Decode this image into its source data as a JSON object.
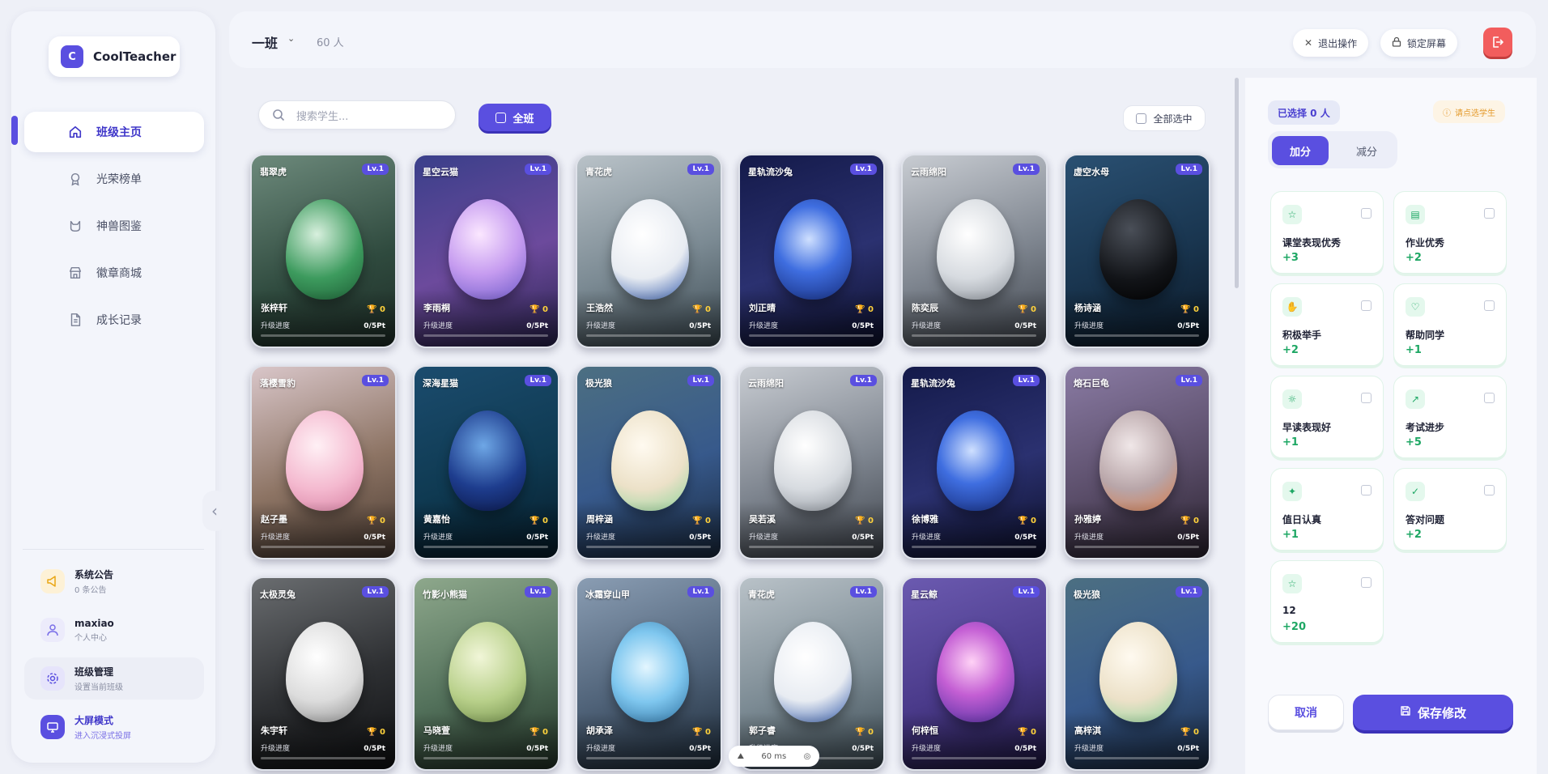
{
  "app": {
    "logo_letter": "C",
    "name": "CoolTeacher"
  },
  "nav": [
    {
      "label": "班级主页",
      "icon": "home-icon",
      "active": true
    },
    {
      "label": "光荣榜单",
      "icon": "medal-icon",
      "active": false
    },
    {
      "label": "神兽图鉴",
      "icon": "cat-icon",
      "active": false
    },
    {
      "label": "徽章商城",
      "icon": "store-icon",
      "active": false
    },
    {
      "label": "成长记录",
      "icon": "document-icon",
      "active": false
    }
  ],
  "sidebar_bottom": [
    {
      "title": "系统公告",
      "subtitle": "0 条公告",
      "icon": "megaphone-icon",
      "color": "#f5b833"
    },
    {
      "title": "maxiao",
      "subtitle": "个人中心",
      "icon": "user-icon",
      "color": "#7a6fe8"
    },
    {
      "title": "班级管理",
      "subtitle": "设置当前班级",
      "icon": "gear-icon",
      "color": "#5a4fe0"
    },
    {
      "title": "大屏模式",
      "subtitle": "进入沉浸式投屏",
      "icon": "monitor-icon",
      "color": "#5a4fe0"
    }
  ],
  "header": {
    "class_name": "一班",
    "student_count": "60 人",
    "exit_label": "退出操作",
    "lock_label": "锁定屏幕"
  },
  "toolbar": {
    "search_placeholder": "搜索学生...",
    "all_label": "全班",
    "select_all_label": "全部选中"
  },
  "card_labels": {
    "level": "Lv.1",
    "progress_label": "升级进度",
    "progress_value": "0/5Pt",
    "points": "0"
  },
  "students": [
    {
      "pet": "翡翠虎",
      "name": "张梓轩",
      "theme": "jade"
    },
    {
      "pet": "星空云猫",
      "name": "李雨桐",
      "theme": "starcat"
    },
    {
      "pet": "青花虎",
      "name": "王浩然",
      "theme": "porcelain"
    },
    {
      "pet": "星轨流沙兔",
      "name": "刘正晴",
      "theme": "galaxy"
    },
    {
      "pet": "云雨绵阳",
      "name": "陈奕辰",
      "theme": "cloud"
    },
    {
      "pet": "虚空水母",
      "name": "杨诗涵",
      "theme": "void"
    },
    {
      "pet": "落樱雪豹",
      "name": "赵子墨",
      "theme": "sakura"
    },
    {
      "pet": "深海星猫",
      "name": "黄嘉怡",
      "theme": "deepsea"
    },
    {
      "pet": "极光狼",
      "name": "周梓涵",
      "theme": "aurora"
    },
    {
      "pet": "云雨绵阳",
      "name": "吴若溪",
      "theme": "cloud"
    },
    {
      "pet": "星轨流沙兔",
      "name": "徐博雅",
      "theme": "galaxy"
    },
    {
      "pet": "熔石巨龟",
      "name": "孙雅婷",
      "theme": "lava"
    },
    {
      "pet": "太极灵兔",
      "name": "朱宇轩",
      "theme": "taiji"
    },
    {
      "pet": "竹影小熊猫",
      "name": "马晓萱",
      "theme": "bamboo"
    },
    {
      "pet": "冰霜穿山甲",
      "name": "胡承泽",
      "theme": "ice"
    },
    {
      "pet": "青花虎",
      "name": "郭子睿",
      "theme": "porcelain"
    },
    {
      "pet": "星云鲸",
      "name": "何梓恒",
      "theme": "nebula"
    },
    {
      "pet": "极光狼",
      "name": "高梓淇",
      "theme": "aurora"
    }
  ],
  "fps": {
    "value": "60 ms"
  },
  "panel": {
    "selected": "已选择 0 人",
    "hint": "请点选学生",
    "add_tab": "加分",
    "minus_tab": "减分",
    "actions": [
      {
        "label": "课堂表现优秀",
        "value": "+3",
        "icon": "star-icon"
      },
      {
        "label": "作业优秀",
        "value": "+2",
        "icon": "clipboard-icon"
      },
      {
        "label": "积极举手",
        "value": "+2",
        "icon": "hand-icon"
      },
      {
        "label": "帮助同学",
        "value": "+1",
        "icon": "heart-icon"
      },
      {
        "label": "早读表现好",
        "value": "+1",
        "icon": "sun-icon"
      },
      {
        "label": "考试进步",
        "value": "+5",
        "icon": "trending-up-icon"
      },
      {
        "label": "值日认真",
        "value": "+1",
        "icon": "sparkle-icon"
      },
      {
        "label": "答对问题",
        "value": "+2",
        "icon": "check-circle-icon"
      },
      {
        "label": "12",
        "value": "+20",
        "icon": "star-icon"
      }
    ],
    "cancel_label": "取消",
    "save_label": "保存修改"
  },
  "colors": {
    "accent": "#5a4fe0",
    "success": "#1ea764",
    "danger": "#f25d5d",
    "warning": "#e49a2c"
  }
}
